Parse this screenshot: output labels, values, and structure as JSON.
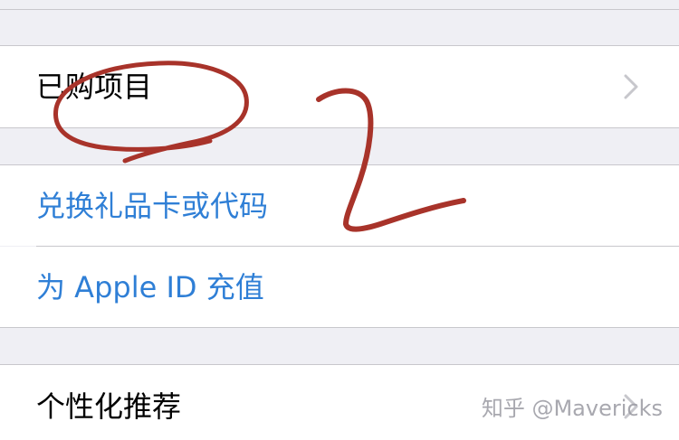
{
  "rows": {
    "purchased": {
      "label": "已购项目",
      "icon": "chevron-right-icon"
    },
    "redeem": {
      "label": "兑换礼品卡或代码"
    },
    "add_funds": {
      "label": "为 Apple ID 充值"
    },
    "personalized": {
      "label": "个性化推荐",
      "icon": "chevron-right-icon"
    }
  },
  "annotation": {
    "number": "2",
    "color": "#a8332a"
  },
  "watermark": "知乎 @Mavericks",
  "colors": {
    "background": "#efeff4",
    "cell": "#ffffff",
    "separator": "#c8c7cc",
    "link": "#2f7fd6",
    "chevron": "#c7c7cc"
  }
}
